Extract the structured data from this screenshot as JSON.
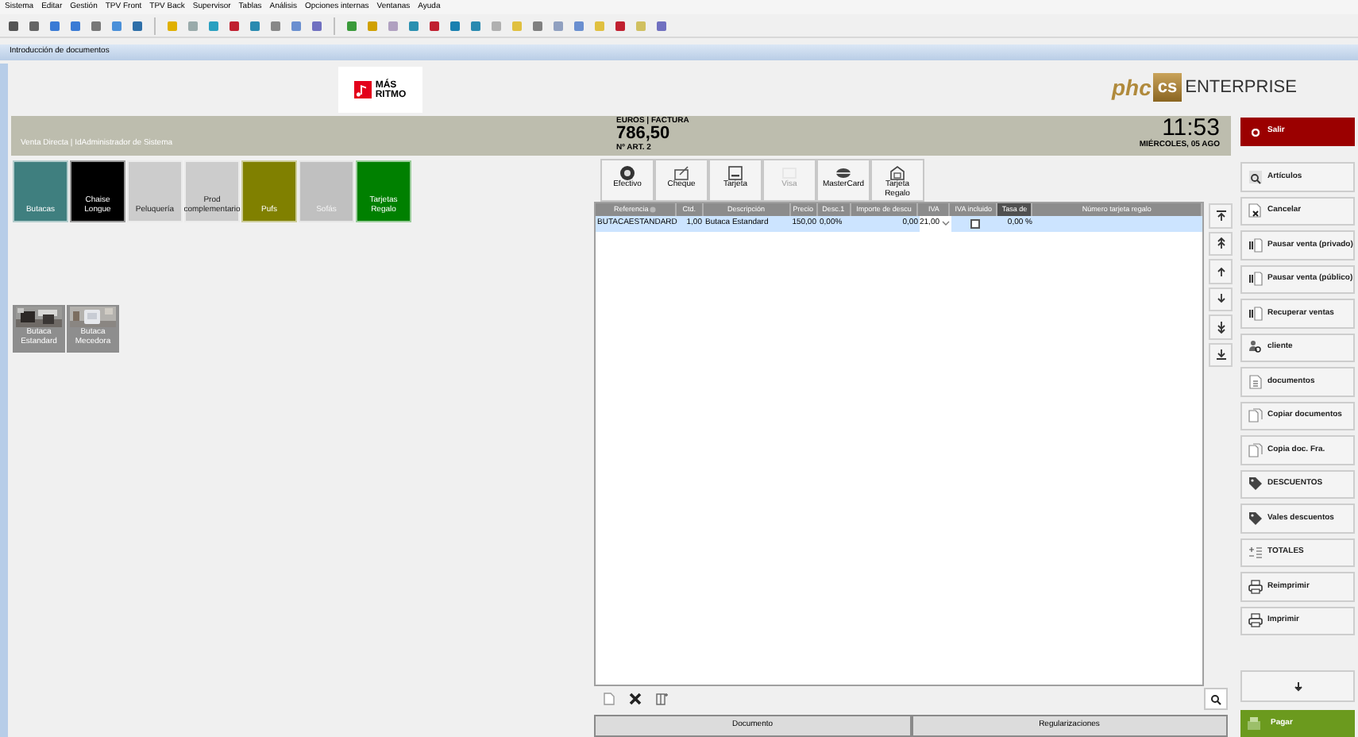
{
  "menu": [
    "Sistema",
    "Editar",
    "Gestión",
    "TPV Front",
    "TPV Back",
    "Supervisor",
    "Tablas",
    "Análisis",
    "Opciones internas",
    "Ventanas",
    "Ayuda"
  ],
  "window": {
    "title": "Introducción de documentos"
  },
  "header": {
    "store_logo": [
      "MÁS",
      "RITMO"
    ],
    "brand_mark": "phc",
    "brand_badge": "cs",
    "brand_name": "ENTERPRISE"
  },
  "info_bar": {
    "context": "Venta Directa | IdAdministrador de Sistema",
    "currency_document": "EUROS | FACTURA",
    "total": "786,50",
    "articles": "Nº ART. 2",
    "time": "11:53",
    "date": "MIÉRCOLES, 05 AGO"
  },
  "exit_button": "Salir",
  "categories": [
    {
      "label": "Butacas",
      "color": "#3f7f7f"
    },
    {
      "label": "Chaise Longue",
      "color": "#000000"
    },
    {
      "label": "Peluquería",
      "color": "#cccccc"
    },
    {
      "label": "Prod complementario",
      "color": "#cccccc"
    },
    {
      "label": "Pufs",
      "color": "#808000"
    },
    {
      "label": "Sofás",
      "color": "#c0c0c0"
    },
    {
      "label": "Tarjetas Regalo",
      "color": "#008000"
    }
  ],
  "products": [
    {
      "label": "Butaca Estandard",
      "kind": "picture"
    },
    {
      "label": "Butaca Mecedora",
      "kind": "picture"
    }
  ],
  "payment_methods": [
    {
      "label": "Efectivo",
      "disabled": false
    },
    {
      "label": "Cheque",
      "disabled": false
    },
    {
      "label": "Tarjeta",
      "disabled": false
    },
    {
      "label": "Visa",
      "disabled": true
    },
    {
      "label": "MasterCard",
      "disabled": false
    },
    {
      "label": "Tarjeta Regalo",
      "disabled": false
    }
  ],
  "table": {
    "columns": [
      {
        "label": "Referencia",
        "highlighted": false
      },
      {
        "label": "Ctd.",
        "highlighted": false
      },
      {
        "label": "Descripción",
        "highlighted": false
      },
      {
        "label": "Precio",
        "highlighted": false
      },
      {
        "label": "Desc.1",
        "highlighted": false
      },
      {
        "label": "Importe de descu",
        "highlighted": false
      },
      {
        "label": "IVA",
        "highlighted": false
      },
      {
        "label": "IVA incluido",
        "highlighted": false
      },
      {
        "label": "Tasa de",
        "highlighted": true
      },
      {
        "label": "Número tarjeta regalo",
        "highlighted": false
      }
    ],
    "rows": [
      {
        "selected": true,
        "cells": [
          {
            "kind": "text",
            "text": "BUTACAESTANDARD"
          },
          {
            "kind": "number",
            "text": "1,00"
          },
          {
            "kind": "text",
            "text": "Butaca Estandard"
          },
          {
            "kind": "number",
            "text": "150,00"
          },
          {
            "kind": "text",
            "text": "0,00%"
          },
          {
            "kind": "number",
            "text": "0,00"
          },
          {
            "kind": "select",
            "text": "21,00"
          },
          {
            "kind": "checkbox",
            "checked": false
          },
          {
            "kind": "number",
            "text": "0,00 %"
          }
        ]
      }
    ]
  },
  "bottom_tabs": [
    "Documento",
    "Regularizaciones"
  ],
  "actions": [
    "Artículos",
    "Cancelar",
    "Pausar venta (privado)",
    "Pausar venta (público)",
    "Recuperar ventas",
    "cliente",
    "documentos",
    "Copiar documentos",
    "Copia doc. Fra.",
    "DESCUENTOS",
    "Vales descuentos",
    "TOTALES",
    "Reimprimir",
    "Imprimir"
  ],
  "pay_button": "Pagar"
}
